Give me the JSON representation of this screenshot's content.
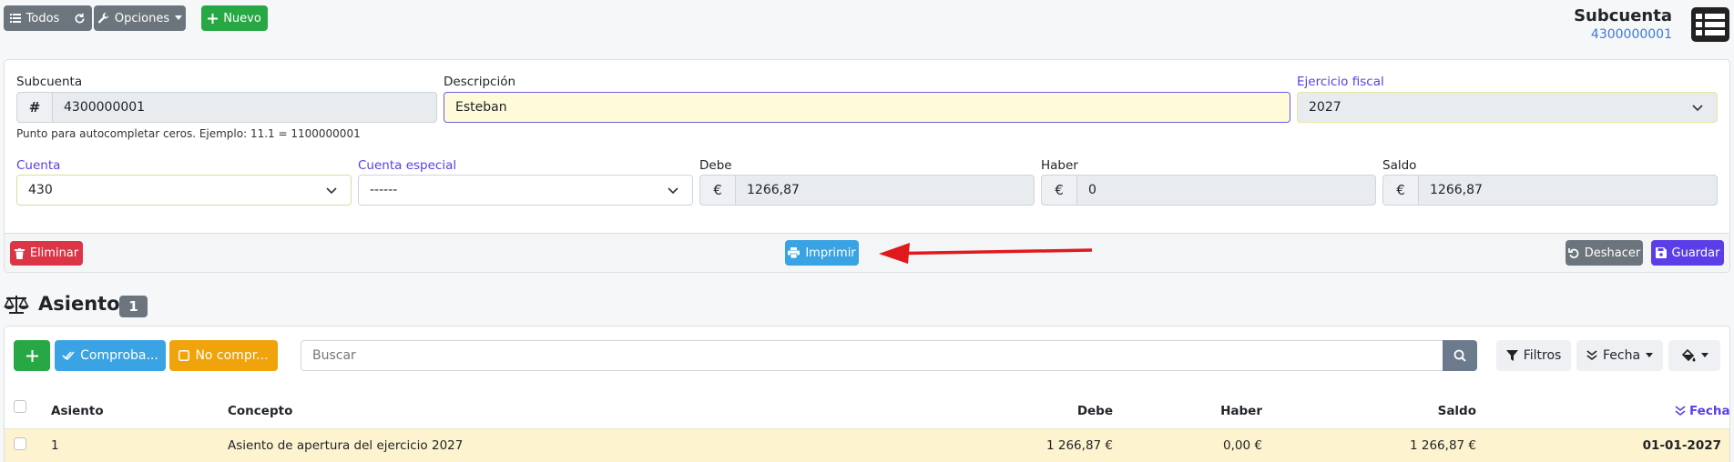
{
  "toolbar": {
    "todos_label": "Todos",
    "opciones_label": "Opciones",
    "nuevo_label": "Nuevo"
  },
  "header": {
    "title": "Subcuenta",
    "subtitle": "4300000001"
  },
  "form": {
    "subcuenta": {
      "label": "Subcuenta",
      "addon": "#",
      "value": "4300000001",
      "help": "Punto para autocompletar ceros. Ejemplo: 11.1 = 1100000001"
    },
    "descripcion": {
      "label": "Descripción",
      "value": "Esteban"
    },
    "ejercicio": {
      "label": "Ejercicio fiscal",
      "value": "2027"
    },
    "cuenta": {
      "label": "Cuenta",
      "value": "430"
    },
    "cuenta_especial": {
      "label": "Cuenta especial",
      "value": "------"
    },
    "debe": {
      "label": "Debe",
      "addon": "€",
      "value": "1266,87"
    },
    "haber": {
      "label": "Haber",
      "addon": "€",
      "value": "0"
    },
    "saldo": {
      "label": "Saldo",
      "addon": "€",
      "value": "1266,87"
    }
  },
  "actions": {
    "eliminar_label": "Eliminar",
    "imprimir_label": "Imprimir",
    "deshacer_label": "Deshacer",
    "guardar_label": "Guardar"
  },
  "asientos": {
    "title": "Asientos",
    "count": "1",
    "comprobado_label": "Comproba...",
    "no_comprobado_label": "No compr...",
    "search_placeholder": "Buscar",
    "filtros_label": "Filtros",
    "fecha_sort_label": "Fecha",
    "columns": {
      "asiento": "Asiento",
      "concepto": "Concepto",
      "debe": "Debe",
      "haber": "Haber",
      "saldo": "Saldo",
      "fecha": "Fecha"
    },
    "rows": [
      {
        "asiento": "1",
        "concepto": "Asiento de apertura del ejercicio 2027",
        "debe": "1 266,87 €",
        "haber": "0,00 €",
        "saldo": "1 266,87 €",
        "fecha": "01-01-2027"
      }
    ]
  },
  "colors": {
    "primary_purple": "#5b3ee8",
    "danger": "#dc3545",
    "success": "#28a745",
    "info": "#3aa3e3",
    "warning": "#f0a30a",
    "row_highlight": "#fdf3cf",
    "annotation_arrow": "#e0191f"
  },
  "icons": [
    "list-icon",
    "refresh-icon",
    "wrench-icon",
    "plus-icon",
    "table-list-icon",
    "trash-icon",
    "print-icon",
    "undo-icon",
    "save-icon",
    "balance-scale-icon",
    "check-double-icon",
    "square-icon",
    "search-icon",
    "filter-icon",
    "sort-desc-icon",
    "fill-bucket-icon"
  ]
}
